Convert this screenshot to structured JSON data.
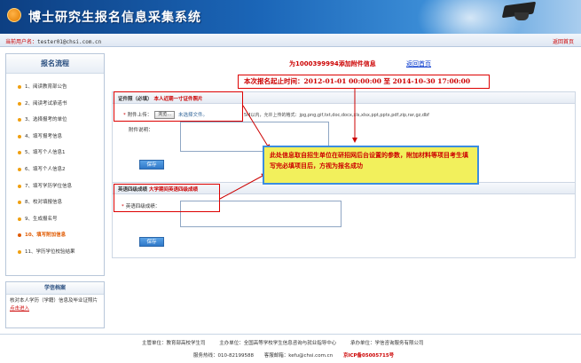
{
  "header": {
    "title": "博士研究生报名信息采集系统",
    "current_user_label": "当前用户名：",
    "current_user": "tester01@chsi.com.cn",
    "back_home": "返回首页"
  },
  "sidebar": {
    "flow_title": "报名流程",
    "steps": [
      "1、阅读教育部公告",
      "2、阅读考试承诺书",
      "3、选择报考的单位",
      "4、填写报考信息",
      "5、填写个人信息1",
      "6、填写个人信息2",
      "7、填写学历学位信息",
      "8、校对填报信息",
      "9、生成报名号",
      "10、填写附加信息",
      "11、学历学位校验结果"
    ],
    "current_step_index": 9,
    "archive_title": "学信档案",
    "archive_text": "核对本人学历（学籍）信息及毕业证照片",
    "archive_link": "点击进入"
  },
  "main": {
    "page_title": "为1000399994添加附件信息",
    "home_link": "返回首页",
    "deadline": "本次报名起止时间：2012-01-01 00:00:00 至 2014-10-30 17:00:00",
    "cert_section": {
      "title": "证件照（必填）",
      "note": "本人近期一寸证件照片",
      "upload_label": "附件上传：",
      "browse_button": "浏览...",
      "no_file": "未选择文件。",
      "format_hint": "5M以内，允许上传的格式：jpg,png,gif,txt,doc,docx,xls,xlsx,ppt,pptx,pdf,zip,rar,gz,dbf",
      "desc_label": "附件说明：",
      "save_button": "保存"
    },
    "english_section": {
      "title": "英语四级成绩",
      "note": "大学期间英语四级成绩",
      "score_label": "英语四级成绩：",
      "save_button": "保存"
    },
    "tooltip": "此处信息取自招生单位在研招网后台设置的参数，附加材料等项目考生填写完必填项目后，方视为报名成功"
  },
  "footer": {
    "organizer": "主管单位：教育部高校学生司",
    "host": "主办单位：全国高等学校学生信息咨询与就业指导中心",
    "support": "承办单位：学信咨询服务有限公司",
    "hotline": "服务热线：010-82199588",
    "email": "客服邮箱：kefu@chsi.com.cn",
    "icp": "京ICP备05005715号"
  },
  "colors": {
    "accent_blue": "#1b66b8",
    "alert_red": "#cc0000",
    "step_current": "#e05a00",
    "tooltip_bg": "#f2f05c"
  }
}
